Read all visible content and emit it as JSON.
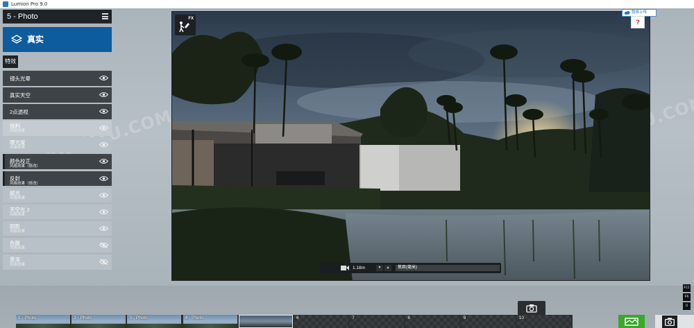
{
  "window": {
    "title": "Lumion Pro 9.0"
  },
  "sidebar": {
    "panel_title": "5 - Photo",
    "style_label": "真实",
    "effects_tab": "特效",
    "effects": [
      {
        "name": "镜头光晕",
        "sub": "",
        "type": "header",
        "eye": "visible"
      },
      {
        "name": "真实天空",
        "sub": "",
        "type": "header",
        "eye": "visible"
      },
      {
        "name": "2点透视",
        "sub": "",
        "type": "header",
        "eye": "visible"
      },
      {
        "name": "锐利",
        "sub": "风格效果",
        "type": "item",
        "eye": "visible"
      },
      {
        "name": "曝光度",
        "sub": "风格效果",
        "type": "item",
        "eye": "visible"
      },
      {
        "name": "颜色校正",
        "sub": "风格效果（修改）",
        "type": "header",
        "eye": "visible"
      },
      {
        "name": "反射",
        "sub": "风格效果（修改）",
        "type": "header",
        "eye": "visible"
      },
      {
        "name": "超光",
        "sub": "风格效果",
        "type": "item",
        "eye": "visible"
      },
      {
        "name": "天空光 2",
        "sub": "风格效果",
        "type": "item",
        "eye": "visible"
      },
      {
        "name": "阴影",
        "sub": "风格效果",
        "type": "item",
        "eye": "visible"
      },
      {
        "name": "色散",
        "sub": "风格效果",
        "type": "item",
        "eye": "hidden"
      },
      {
        "name": "景深",
        "sub": "风格效果",
        "type": "item",
        "eye": "hidden"
      }
    ]
  },
  "viewport": {
    "fx_badge": "FX",
    "camera_height": "1.18m",
    "focal_length_field": "焦距(毫米)"
  },
  "top_right": {
    "link_label": "我将上传",
    "help": "?"
  },
  "function_keys": [
    "F11",
    "F6",
    "U"
  ],
  "photo_set": {
    "slots": [
      {
        "label": "1 - Photo",
        "state": "filled"
      },
      {
        "label": "2 - Photo",
        "state": "filled"
      },
      {
        "label": "3 - Photo",
        "state": "filled"
      },
      {
        "label": "4 - Photo",
        "state": "filled"
      },
      {
        "label": "",
        "state": "selected"
      },
      {
        "label": "6",
        "state": "empty"
      },
      {
        "label": "7",
        "state": "empty"
      },
      {
        "label": "8",
        "state": "empty"
      },
      {
        "label": "9",
        "state": "empty"
      },
      {
        "label": "10",
        "state": "empty"
      }
    ]
  },
  "watermark": "ARCHTU.COM",
  "colors": {
    "accent": "#0d5c9e",
    "panel_dark": "#1f2326",
    "effect_dark": "#3d4347",
    "effect_light": "#b8c1c7",
    "render_green": "#3aa82a",
    "help_red": "#c31818"
  }
}
